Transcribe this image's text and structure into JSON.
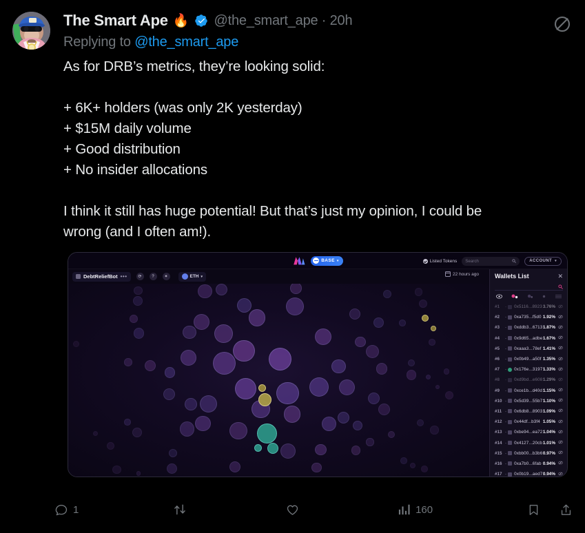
{
  "tweet": {
    "display_name": "The Smart Ape",
    "name_emoji": "🔥",
    "verified_icon": "verified-badge-icon",
    "handle": "@the_smart_ape",
    "separator": "·",
    "timestamp": "20h",
    "replying_prefix": "Replying to",
    "replying_mention": "@the_smart_ape",
    "grok_icon": "grok-slash-icon",
    "body": "As for DRB’s metrics, they’re looking solid:\n\n+ 6K+ holders (was only 2K yesterday)\n+ $15M daily volume\n+ Good distribution\n+ No insider allocations\n\nI think it still has huge potential! But that’s just my opinion, I could be\nwrong (and I often am!)."
  },
  "actions": {
    "reply": {
      "icon": "reply-icon",
      "count": "1"
    },
    "retweet": {
      "icon": "retweet-icon",
      "count": ""
    },
    "like": {
      "icon": "heart-icon",
      "count": ""
    },
    "views": {
      "icon": "analytics-icon",
      "count": "160"
    },
    "bookmark": {
      "icon": "bookmark-icon"
    },
    "share": {
      "icon": "share-icon"
    }
  },
  "media": {
    "app_header": {
      "logo": "bubblemaps-logo-icon",
      "chain_pill": "BASE",
      "chain_caret": "▾",
      "listed_tokens": "Listed Tokens",
      "search_placeholder": "Search",
      "search_icon": "search-icon",
      "account_label": "ACCOUNT",
      "account_caret": "▾"
    },
    "toolbar": {
      "token_name": "DebtReliefBot",
      "token_more": "•••",
      "refresh_icon": "refresh-icon",
      "help_icon": "help-icon",
      "settings_icon": "gear-icon",
      "network_label": "ETH",
      "network_caret": "▾"
    },
    "time_badge": {
      "icon": "calendar-icon",
      "label": "22 hours ago"
    },
    "wallets_panel": {
      "title": "Wallets List",
      "close_icon": "close-icon",
      "search_icon": "search-icon",
      "filter_icons": [
        "eye-icon",
        "cluster-icon",
        "contract-icon",
        "dot-icon",
        "list-icon"
      ],
      "rows": [
        {
          "rank": "#1",
          "address": "0x5116...8923",
          "percent": "3.76%",
          "tag": "contract",
          "dim": true
        },
        {
          "rank": "#2",
          "address": "0xa735...f5d0",
          "percent": "1.92%",
          "tag": "wallet",
          "dim": false
        },
        {
          "rank": "#3",
          "address": "0xddb3...6713",
          "percent": "1.87%",
          "tag": "wallet",
          "dim": false
        },
        {
          "rank": "#4",
          "address": "0x9d65...adbe",
          "percent": "1.67%",
          "tag": "wallet",
          "dim": false
        },
        {
          "rank": "#5",
          "address": "0xaaa3...78ef",
          "percent": "1.41%",
          "tag": "wallet",
          "dim": false
        },
        {
          "rank": "#6",
          "address": "0x0b49...a50f",
          "percent": "1.35%",
          "tag": "wallet",
          "dim": false
        },
        {
          "rank": "#7",
          "address": "0x176e...3197",
          "percent": "1.33%",
          "tag": "green",
          "dim": false
        },
        {
          "rank": "#8",
          "address": "0xd9bd...e608",
          "percent": "1.29%",
          "tag": "contract",
          "dim": true
        },
        {
          "rank": "#9",
          "address": "0xce1b...d40d",
          "percent": "1.15%",
          "tag": "wallet",
          "dim": false
        },
        {
          "rank": "#10",
          "address": "0x5d39...55b7",
          "percent": "1.10%",
          "tag": "wallet",
          "dim": false
        },
        {
          "rank": "#11",
          "address": "0x6db8...8903",
          "percent": "1.09%",
          "tag": "wallet",
          "dim": false
        },
        {
          "rank": "#12",
          "address": "0x44df...b3f4",
          "percent": "1.05%",
          "tag": "wallet",
          "dim": false
        },
        {
          "rank": "#13",
          "address": "0xbe94...ea72",
          "percent": "1.04%",
          "tag": "wallet",
          "dim": false
        },
        {
          "rank": "#14",
          "address": "0x4127...20cb",
          "percent": "1.01%",
          "tag": "wallet",
          "dim": false
        },
        {
          "rank": "#15",
          "address": "0xbb00...b3b6",
          "percent": "0.97%",
          "tag": "wallet",
          "dim": false
        },
        {
          "rank": "#16",
          "address": "0xa7b0...6fab",
          "percent": "0.94%",
          "tag": "wallet",
          "dim": false
        },
        {
          "rank": "#17",
          "address": "0x0b19...aed7",
          "percent": "0.94%",
          "tag": "wallet",
          "dim": false
        }
      ]
    },
    "bubble_map": {
      "description": "token holder bubble map",
      "colors": {
        "bubble": "#3a2d6b",
        "highlight_teal": "#2e9e8a",
        "highlight_yellow": "#b9a14a",
        "background": "#120a22"
      }
    }
  },
  "colors": {
    "accent_blue": "#1d9bf0",
    "text_primary": "#e7e9ea",
    "text_muted": "#71767b",
    "background": "#000000",
    "pink": "#e0408a"
  }
}
